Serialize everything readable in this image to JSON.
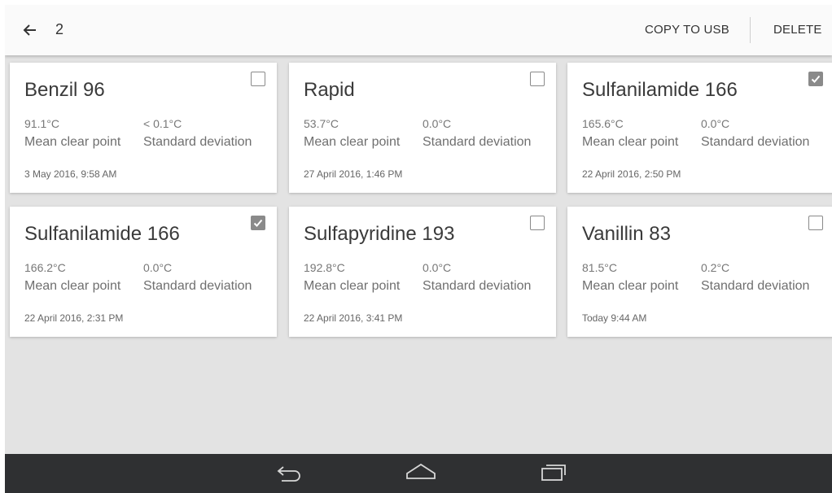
{
  "header": {
    "selected_count": "2",
    "copy_label": "COPY TO USB",
    "delete_label": "DELETE",
    "back_icon": "arrow-left-icon"
  },
  "cards": [
    {
      "title": "Benzil 96",
      "mean_value": "91.1°C",
      "mean_label": "Mean clear point",
      "sd_value": "< 0.1°C",
      "sd_label": "Standard deviation",
      "date": "3 May 2016, 9:58 AM",
      "checked": false
    },
    {
      "title": "Rapid",
      "mean_value": "53.7°C",
      "mean_label": "Mean clear point",
      "sd_value": "0.0°C",
      "sd_label": "Standard deviation",
      "date": "27 April 2016, 1:46 PM",
      "checked": false
    },
    {
      "title": "Sulfanilamide 166",
      "mean_value": "165.6°C",
      "mean_label": "Mean clear point",
      "sd_value": "0.0°C",
      "sd_label": "Standard deviation",
      "date": "22 April 2016, 2:50 PM",
      "checked": true
    },
    {
      "title": "Sulfanilamide 166",
      "mean_value": "166.2°C",
      "mean_label": "Mean clear point",
      "sd_value": "0.0°C",
      "sd_label": "Standard deviation",
      "date": "22 April 2016, 2:31 PM",
      "checked": true
    },
    {
      "title": "Sulfapyridine 193",
      "mean_value": "192.8°C",
      "mean_label": "Mean clear point",
      "sd_value": "0.0°C",
      "sd_label": "Standard deviation",
      "date": "22 April 2016, 3:41 PM",
      "checked": false
    },
    {
      "title": "Vanillin 83",
      "mean_value": "81.5°C",
      "mean_label": "Mean clear point",
      "sd_value": "0.2°C",
      "sd_label": "Standard deviation",
      "date": "Today 9:44 AM",
      "checked": false
    }
  ],
  "navbar": {
    "icons": [
      "back-icon",
      "home-icon",
      "recents-icon"
    ],
    "background": "#2f3032"
  },
  "colors": {
    "checkbox_checked": "#8a8a8a",
    "page_background": "#e3e3e3"
  }
}
